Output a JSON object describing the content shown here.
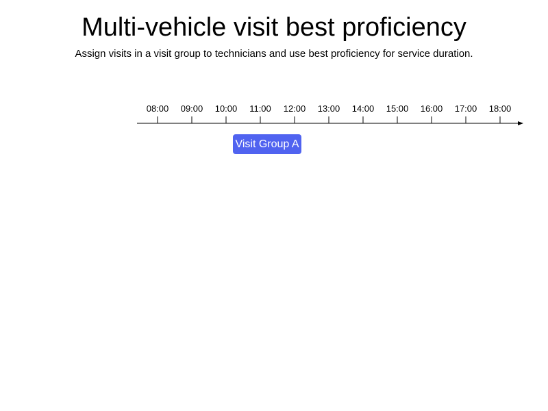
{
  "header": {
    "title": "Multi-vehicle visit best proficiency",
    "subtitle": "Assign visits in a visit group to technicians and use best proficiency for service duration."
  },
  "timeline": {
    "ticks": [
      "08:00",
      "09:00",
      "10:00",
      "11:00",
      "12:00",
      "13:00",
      "14:00",
      "15:00",
      "16:00",
      "17:00",
      "18:00"
    ],
    "axis_color": "#000000"
  },
  "visit_groups": [
    {
      "label": "Visit Group A",
      "start": "10:12",
      "end": "12:12",
      "color": "#5063f0"
    }
  ]
}
